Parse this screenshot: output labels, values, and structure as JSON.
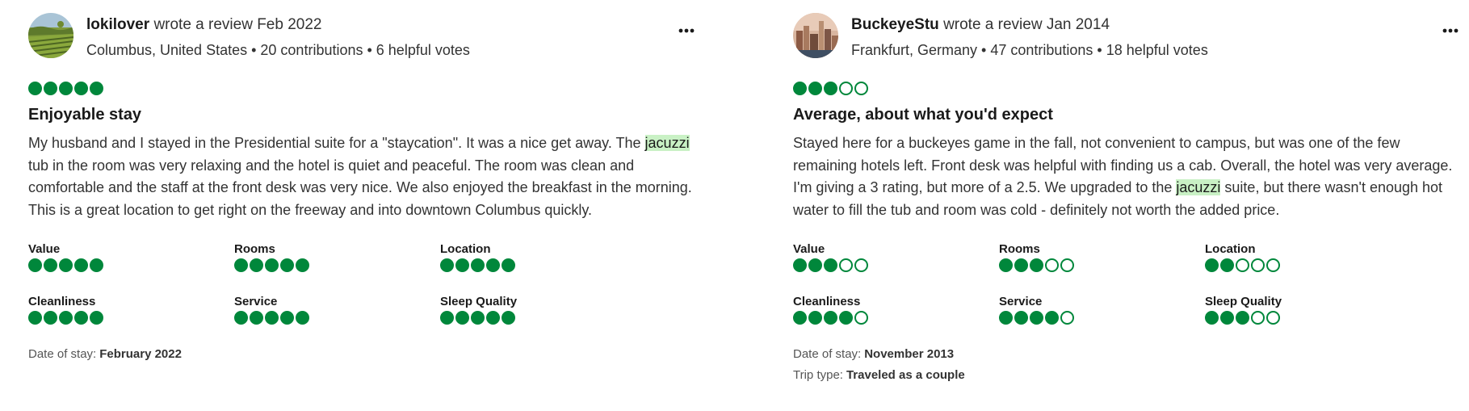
{
  "colors": {
    "bubble": "#00873b",
    "highlight": "#c9f1c5"
  },
  "reviews": [
    {
      "author": "lokilover",
      "action": "wrote a review Feb 2022",
      "meta": "Columbus, United States • 20 contributions • 6 helpful votes",
      "more_icon": "more-horizontal-icon",
      "rating": 5,
      "title": "Enjoyable stay",
      "body_parts": [
        "My husband and I stayed in the Presidential suite for a \"staycation\". It was a nice get away. The ",
        "jacuzzi",
        " tub in the room was very relaxing and the hotel is quiet and peaceful. The room was clean and comfortable and the staff at the front desk was very nice. We also enjoyed the breakfast in the morning. This is a great location to get right on the freeway and into downtown Columbus quickly."
      ],
      "sub_ratings": [
        {
          "label": "Value",
          "rating": 5
        },
        {
          "label": "Rooms",
          "rating": 5
        },
        {
          "label": "Location",
          "rating": 5
        },
        {
          "label": "Cleanliness",
          "rating": 5
        },
        {
          "label": "Service",
          "rating": 5
        },
        {
          "label": "Sleep Quality",
          "rating": 5
        }
      ],
      "date_of_stay_label": "Date of stay:",
      "date_of_stay": "February 2022"
    },
    {
      "author": "BuckeyeStu",
      "action": "wrote a review Jan 2014",
      "meta": "Frankfurt, Germany • 47 contributions • 18 helpful votes",
      "more_icon": "more-horizontal-icon",
      "rating": 3,
      "title": "Average, about what you'd expect",
      "body_parts": [
        "Stayed here for a buckeyes game in the fall, not convenient to campus, but was one of the few remaining hotels left. Front desk was helpful with finding us a cab. Overall, the hotel was very average. I'm giving a 3 rating, but more of a 2.5. We upgraded to the ",
        "jacuzzi",
        " suite, but there wasn't enough hot water to fill the tub and room was cold - definitely not worth the added price."
      ],
      "sub_ratings": [
        {
          "label": "Value",
          "rating": 3
        },
        {
          "label": "Rooms",
          "rating": 3
        },
        {
          "label": "Location",
          "rating": 2
        },
        {
          "label": "Cleanliness",
          "rating": 4
        },
        {
          "label": "Service",
          "rating": 4
        },
        {
          "label": "Sleep Quality",
          "rating": 3
        }
      ],
      "date_of_stay_label": "Date of stay:",
      "date_of_stay": "November 2013",
      "trip_type_label": "Trip type:",
      "trip_type": "Traveled as a couple"
    }
  ]
}
